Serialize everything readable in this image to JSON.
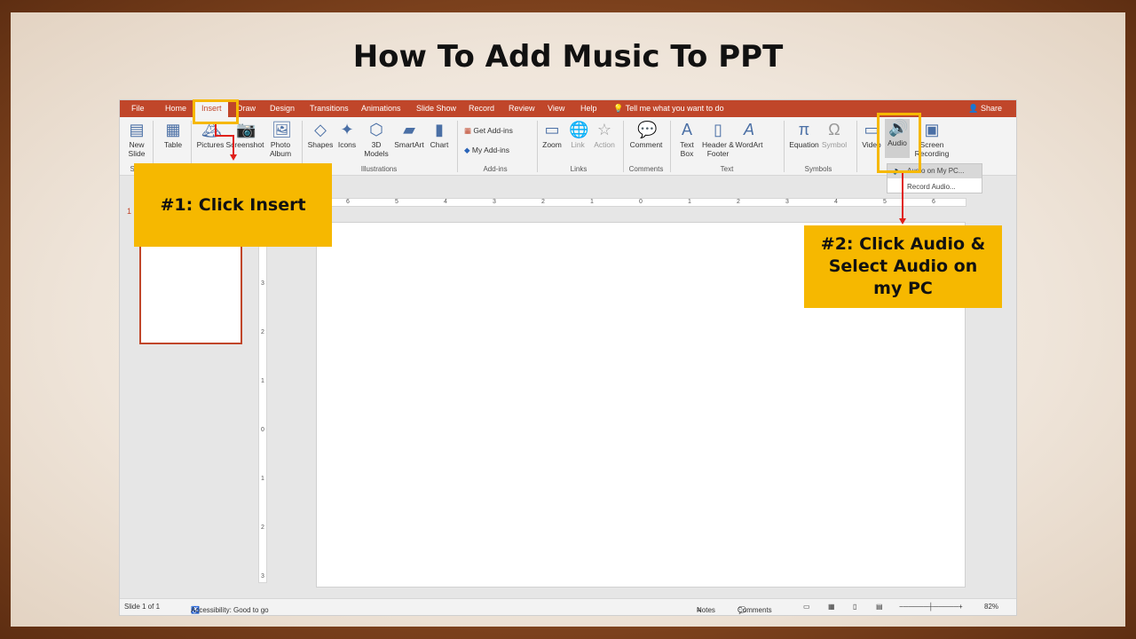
{
  "title": "How To Add Music To PPT",
  "tabs": [
    "File",
    "Home",
    "Insert",
    "Draw",
    "Design",
    "Transitions",
    "Animations",
    "Slide Show",
    "Record",
    "Review",
    "View",
    "Help"
  ],
  "tell_me": "Tell me what you want to do",
  "share": "Share",
  "ribbon": {
    "new_slide": "New Slide",
    "table": "Table",
    "pictures": "Pictures",
    "screenshot": "Screenshot",
    "photo_album": "Photo Album",
    "shapes": "Shapes",
    "icons": "Icons",
    "models_3d": "3D Models",
    "smartart": "SmartArt",
    "chart": "Chart",
    "get_addins": "Get Add-ins",
    "my_addins": "My Add-ins",
    "zoom": "Zoom",
    "link": "Link",
    "action": "Action",
    "comment": "Comment",
    "text_box": "Text Box",
    "header_footer": "Header & Footer",
    "wordart": "WordArt",
    "equation": "Equation",
    "symbol": "Symbol",
    "video": "Video",
    "audio": "Audio",
    "screen_recording": "Screen Recording",
    "groups": {
      "slides": "Sli",
      "illustrations": "Illustrations",
      "addins": "Add-ins",
      "links": "Links",
      "comments": "Comments",
      "text": "Text",
      "symbols": "Symbols"
    }
  },
  "audio_menu": {
    "audio_on_pc": "Audio on My PC...",
    "record_audio": "Record Audio..."
  },
  "thumb_number": "1",
  "ruler_h": [
    "6",
    "5",
    "4",
    "3",
    "2",
    "1",
    "0",
    "1",
    "2",
    "3",
    "4",
    "5",
    "6"
  ],
  "ruler_v": [
    "3",
    "2",
    "1",
    "0",
    "1",
    "2",
    "3"
  ],
  "status": {
    "slide": "Slide 1 of 1",
    "accessibility": "Accessibility: Good to go",
    "notes": "Notes",
    "comments": "Comments",
    "zoom": "82%"
  },
  "callouts": {
    "step1": "#1: Click Insert",
    "step2": "#2: Click Audio & Select Audio on my PC"
  },
  "colors": {
    "accent": "#c0462a",
    "highlight": "#f6b800",
    "arrow": "#e0201a"
  }
}
